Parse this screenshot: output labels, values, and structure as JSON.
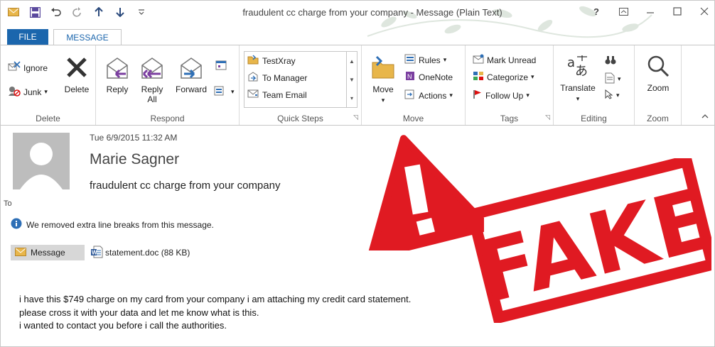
{
  "window": {
    "title": "fraudulent cc charge from your company - Message (Plain Text)",
    "help": "?"
  },
  "tabs": {
    "file": "FILE",
    "message": "MESSAGE"
  },
  "ribbon": {
    "delete_group": {
      "ignore": "Ignore",
      "junk": "Junk",
      "delete": "Delete",
      "label": "Delete"
    },
    "respond_group": {
      "reply": "Reply",
      "reply_all_1": "Reply",
      "reply_all_2": "All",
      "forward": "Forward",
      "label": "Respond"
    },
    "quick_steps": {
      "items": [
        "TestXray",
        "To Manager",
        "Team Email"
      ],
      "label": "Quick Steps"
    },
    "move_group": {
      "move": "Move",
      "rules": "Rules",
      "onenote": "OneNote",
      "actions": "Actions",
      "label": "Move"
    },
    "tags_group": {
      "mark_unread": "Mark Unread",
      "categorize": "Categorize",
      "follow_up": "Follow Up",
      "label": "Tags"
    },
    "editing_group": {
      "translate": "Translate",
      "label": "Editing"
    },
    "zoom_group": {
      "zoom": "Zoom",
      "label": "Zoom"
    }
  },
  "message": {
    "date": "Tue 6/9/2015 11:32 AM",
    "sender": "Marie Sagner",
    "subject": "fraudulent cc charge from your company",
    "to_label": "To",
    "info": "We removed extra line breaks from this message.",
    "message_tab": "Message",
    "attachment": "statement.doc (88 KB)",
    "body": [
      "i have this $749 charge on my card from your company i am attaching my credit card statement.",
      "please cross it with your data and let me know what is this.",
      "i wanted to contact you before i call the authorities."
    ]
  },
  "stamp": {
    "text": "FAKE",
    "color": "#e01a22"
  },
  "colors": {
    "accent": "#1b66ad",
    "purple": "#7b3fa0",
    "stamp": "#e01a22"
  }
}
